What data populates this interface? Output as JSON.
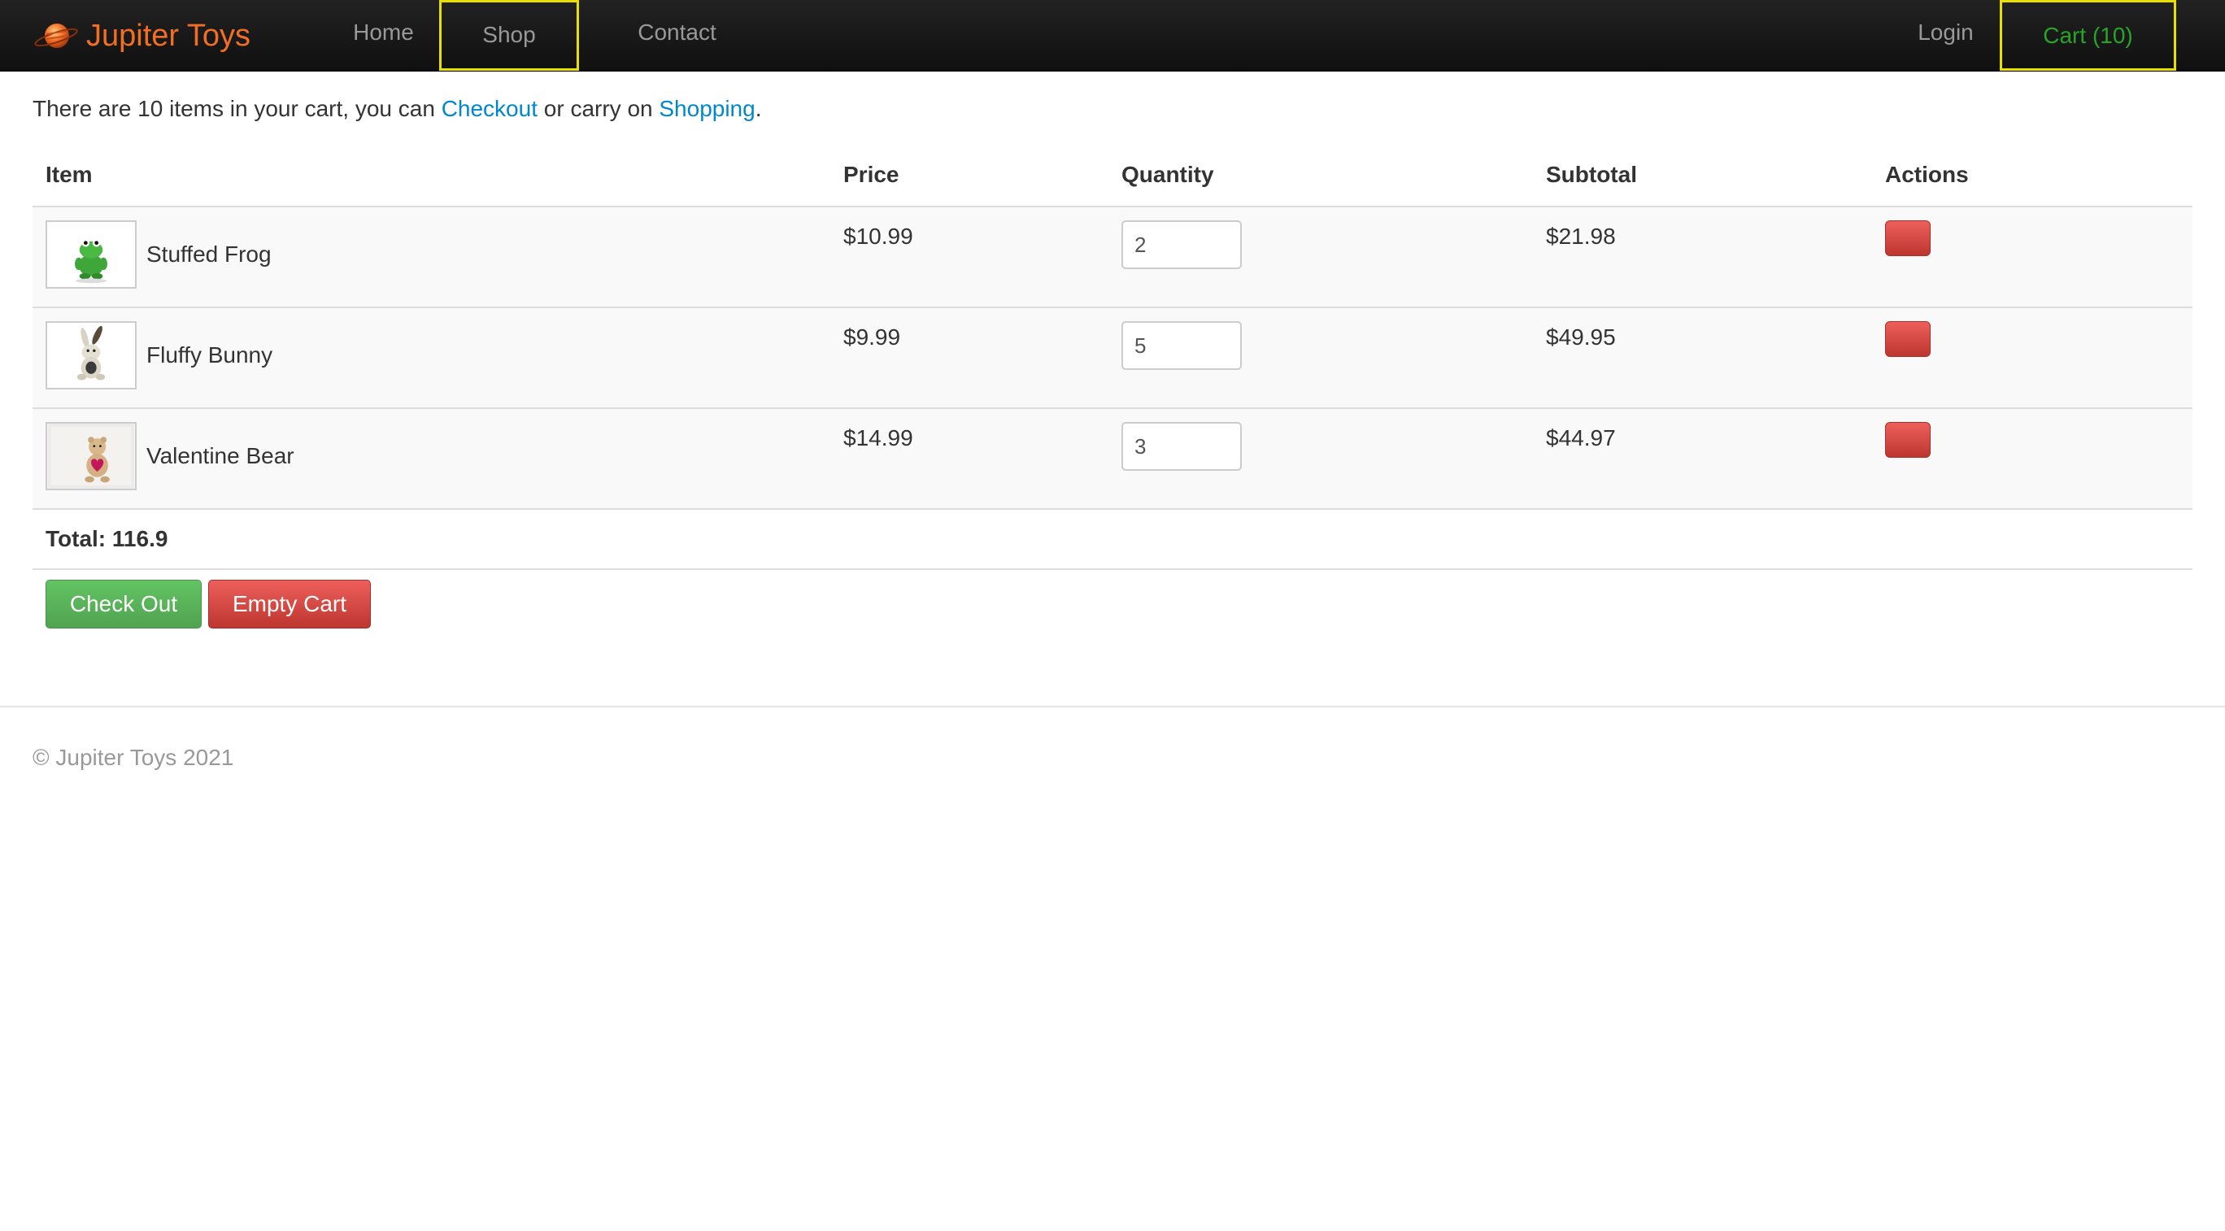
{
  "nav": {
    "brand": "Jupiter Toys",
    "home": "Home",
    "shop": "Shop",
    "contact": "Contact",
    "login": "Login",
    "cart": "Cart (10)"
  },
  "intro": {
    "prefix": "There are 10 items in your cart, you can ",
    "checkout_link": "Checkout",
    "middle": " or carry on ",
    "shopping_link": "Shopping",
    "suffix": "."
  },
  "table": {
    "headers": {
      "item": "Item",
      "price": "Price",
      "quantity": "Quantity",
      "subtotal": "Subtotal",
      "actions": "Actions"
    },
    "rows": [
      {
        "name": "Stuffed Frog",
        "price": "$10.99",
        "quantity": "2",
        "subtotal": "$21.98",
        "thumb": "frog-image"
      },
      {
        "name": "Fluffy Bunny",
        "price": "$9.99",
        "quantity": "5",
        "subtotal": "$49.95",
        "thumb": "bunny-image"
      },
      {
        "name": "Valentine Bear",
        "price": "$14.99",
        "quantity": "3",
        "subtotal": "$44.97",
        "thumb": "bear-image"
      }
    ],
    "total": "Total: 116.9"
  },
  "buttons": {
    "checkout": "Check Out",
    "empty": "Empty Cart"
  },
  "footer": "© Jupiter Toys 2021",
  "colors": {
    "brand": "#f06f25",
    "link": "#0088cc",
    "cart": "#28a428",
    "highlight": "#e8e000",
    "success": "#51a351",
    "danger": "#bd362f"
  }
}
